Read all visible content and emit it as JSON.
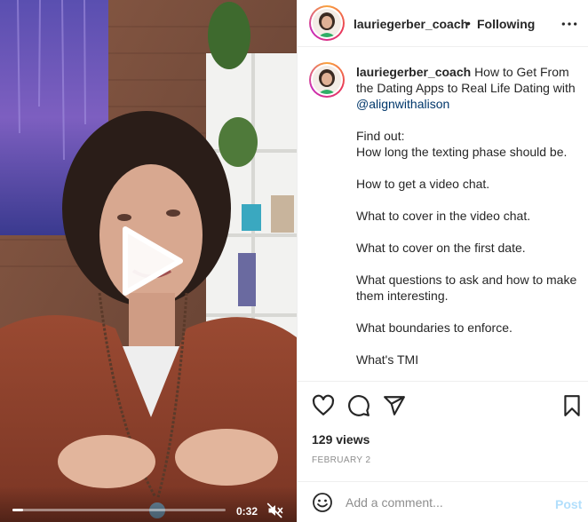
{
  "post": {
    "username": "lauriegerber_coach",
    "separator": "•",
    "follow_status": "Following"
  },
  "caption": {
    "username": "lauriegerber_coach",
    "title_prefix": "How to Get From the Dating Apps to Real Life Dating with ",
    "mention": "@alignwithalison",
    "lines": [
      "Find out:",
      "How long the texting phase should be.",
      "",
      "How to get a video chat.",
      "",
      "What to cover in the video chat.",
      "",
      "What to cover on the first date.",
      "",
      "What questions to ask and how to make them interesting.",
      "",
      "What boundaries to enforce.",
      "",
      "What's TMI"
    ]
  },
  "video": {
    "time": "0:32",
    "progress": 0.05
  },
  "stats": {
    "views": "129 views",
    "date": "FEBRUARY 2"
  },
  "comment": {
    "placeholder": "Add a comment...",
    "post_label": "Post"
  },
  "icons": {
    "play": "play-icon",
    "mute": "speaker-muted-icon",
    "more": "more-dots-icon",
    "like": "heart-icon",
    "comment": "comment-bubble-icon",
    "share": "paper-plane-icon",
    "save": "bookmark-icon",
    "emoji": "smiley-icon"
  },
  "colors": {
    "text": "#262626",
    "muted": "#8e8e8e",
    "mention": "#00376b",
    "post_disabled": "#b2dffc",
    "divider": "#efefef"
  }
}
